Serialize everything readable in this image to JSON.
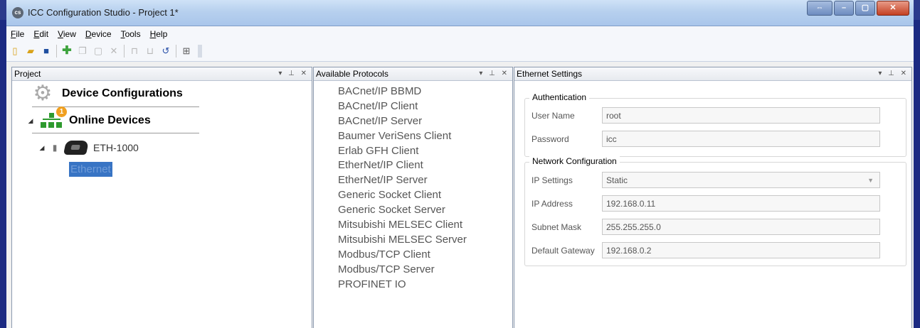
{
  "window": {
    "title": "ICC Configuration Studio - Project 1*",
    "app_icon": "cs",
    "controls": {
      "restore": "⇔",
      "minimize": "–",
      "maximize": "▢",
      "close": "✕"
    }
  },
  "menu": [
    "File",
    "Edit",
    "View",
    "Device",
    "Tools",
    "Help"
  ],
  "toolbar": {
    "new": "▯",
    "open": "▰",
    "save": "■",
    "add": "✚",
    "copy": "❐",
    "paste": "▢",
    "delete": "✕",
    "move_up": "⊓",
    "move_down": "⊔",
    "refresh": "↺",
    "properties": "⊞"
  },
  "panels": {
    "project": {
      "title": "Project",
      "controls": "▾ ⊥ ✕",
      "device_configurations": "Device Configurations",
      "online_devices": "Online Devices",
      "online_badge": "1",
      "device": "ETH-1000",
      "selected_node": "Ethernet",
      "expand_glyph": "◢"
    },
    "protocols": {
      "title": "Available Protocols",
      "controls": "▾ ⊥ ✕",
      "items": [
        "BACnet/IP BBMD",
        "BACnet/IP Client",
        "BACnet/IP Server",
        "Baumer VeriSens Client",
        "Erlab GFH Client",
        "EtherNet/IP Client",
        "EtherNet/IP Server",
        "Generic Socket Client",
        "Generic Socket Server",
        "Mitsubishi MELSEC Client",
        "Mitsubishi MELSEC Server",
        "Modbus/TCP Client",
        "Modbus/TCP Server",
        "PROFINET IO"
      ]
    },
    "ethernet": {
      "title": "Ethernet Settings",
      "controls": "▾ ⊥ ✕",
      "authentication": {
        "title": "Authentication",
        "user_name_label": "User Name",
        "user_name": "root",
        "password_label": "Password",
        "password": "icc"
      },
      "network": {
        "title": "Network Configuration",
        "ip_settings_label": "IP Settings",
        "ip_settings": "Static",
        "ip_address_label": "IP Address",
        "ip_address": "192.168.0.11",
        "subnet_mask_label": "Subnet Mask",
        "subnet_mask": "255.255.255.0",
        "gateway_label": "Default Gateway",
        "gateway": "192.168.0.2",
        "dropdown_arrow": "▼"
      }
    }
  }
}
